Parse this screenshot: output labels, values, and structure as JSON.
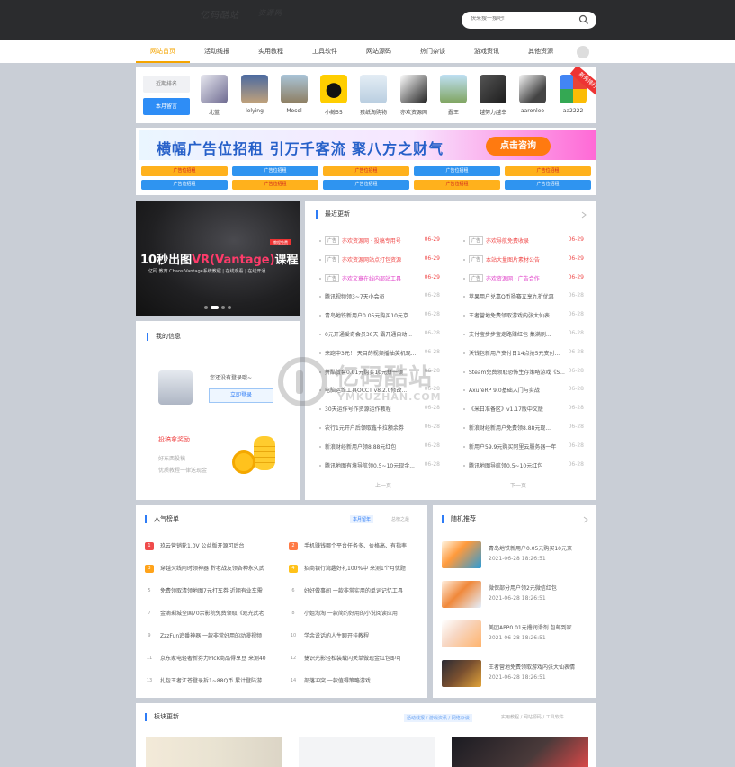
{
  "header": {
    "logo_text": "亿码酷站",
    "logo_sub": "资源网",
    "search_placeholder": "快来搜一搜吧!"
  },
  "nav": [
    "网站首页",
    "活动线报",
    "实用教程",
    "工具软件",
    "网站源码",
    "热门杂谈",
    "游戏资讯",
    "其他资源"
  ],
  "rank_tabs": [
    "近期排名",
    "本月留言"
  ],
  "users": [
    "北蓝",
    "lelying",
    "Mosol",
    "小鲸55",
    "孩纸淘购物",
    "亦欢资源网",
    "蠢王",
    "越努力越幸",
    "aaronleo",
    "aa2222"
  ],
  "ribbon": "新秀排行",
  "banner": {
    "text": "横幅广告位招租 引万千客流 聚八方之财气",
    "button": "点击咨询"
  },
  "ad_slots": [
    "广告位招租",
    "广告位招租",
    "广告位招租",
    "广告位招租",
    "广告位招租",
    "广告位招租",
    "广告位招租",
    "广告位招租",
    "广告位招租",
    "广告位招租"
  ],
  "slide": {
    "title_a": "10秒出图",
    "title_b": "VR(Vantage)",
    "title_c": "课程",
    "sub": "亿码 教育 Chaos Vantage系统教程 | 在线观看 | 在线开通",
    "tag": "教程免费"
  },
  "latest": {
    "title": "最近更新",
    "left": [
      {
        "tag": "广告",
        "text": "亦欢资源网 · 投稿专用号",
        "date": "06-29"
      },
      {
        "tag": "广告",
        "text": "亦欢资源网站点打包资源",
        "date": "06-29"
      },
      {
        "tag": "广告",
        "text": "亦欢文章在线内部站工具",
        "date": "06-29"
      },
      {
        "tag": "",
        "text": "腾讯视频领3~7天小会员",
        "date": "06-28"
      },
      {
        "tag": "",
        "text": "青岛地铁新用户0.05元购买10元京...",
        "date": "06-28"
      },
      {
        "tag": "",
        "text": "0元开通爱奇会员30天 霸开通自动...",
        "date": "06-28"
      },
      {
        "tag": "",
        "text": "来跑中3元！ 天目的视频播抽奖机现...",
        "date": "06-28"
      },
      {
        "tag": "",
        "text": "拼酷赞套0.01元购买10元拼一顿",
        "date": "06-28"
      },
      {
        "tag": "",
        "text": "电脑运维工具OCCT v8.2.0修改...",
        "date": "06-28"
      },
      {
        "tag": "",
        "text": "30天运作号作资源运作教程",
        "date": "06-28"
      },
      {
        "tag": "",
        "text": "农行1元开户后领取鑫卡拉额余券",
        "date": "06-28"
      },
      {
        "tag": "",
        "text": "新浪财经新用户领8.88元红包",
        "date": "06-28"
      },
      {
        "tag": "",
        "text": "腾讯地图有境导航领0.5~10元现金...",
        "date": "06-28"
      }
    ],
    "right": [
      {
        "tag": "广告",
        "text": "亦欢导航免费收录",
        "date": "06-29"
      },
      {
        "tag": "广告",
        "text": "本站大量图片素材公告",
        "date": "06-29"
      },
      {
        "tag": "广告",
        "text": "亦欢资源网 · 广告合作",
        "date": "06-29"
      },
      {
        "tag": "",
        "text": "苹果用户兑嘉Q币扬赛立享九折优惠",
        "date": "06-28"
      },
      {
        "tag": "",
        "text": "王者营地免费领取游戏内张大仙表...",
        "date": "06-28"
      },
      {
        "tag": "",
        "text": "支付宝步步宝走路赚红包 集满刷...",
        "date": "06-28"
      },
      {
        "tag": "",
        "text": "沃钱包新用户支付日14点抢5元支付...",
        "date": "06-28"
      },
      {
        "tag": "",
        "text": "Steam免费领取恐怖生存策略游戏《S...",
        "date": "06-28"
      },
      {
        "tag": "",
        "text": "AxureRP 9.0基础入门与实战",
        "date": "06-28"
      },
      {
        "tag": "",
        "text": "《米日准备区》v1.17版中文版",
        "date": "06-28"
      },
      {
        "tag": "",
        "text": "新浪财经新用户免费领8.88元现...",
        "date": "06-28"
      },
      {
        "tag": "",
        "text": "新用户59.9元购买阿里云服务器一年",
        "date": "06-28"
      },
      {
        "tag": "",
        "text": "腾讯地图导航领0.5~10元红包",
        "date": "06-28"
      }
    ],
    "prev": "上一页",
    "next": "下一页"
  },
  "myinfo": {
    "title": "我的信息",
    "not_logged": "您还没有登录哦~",
    "login": "立即登录",
    "reward": "投稿拿奖励",
    "desc1": "好东西投稿",
    "desc2": "优质教程一律送现金"
  },
  "popular": {
    "title": "人气榜单",
    "tabs": [
      "本月留年",
      "总榜之最"
    ],
    "items": [
      {
        "n": "1",
        "text": "玖云营销轮1.0V 公益版开源可后台"
      },
      {
        "n": "2",
        "text": "手机赚钱哪个平台任务多、价格高、有指率"
      },
      {
        "n": "3",
        "text": "穿越火线阿时领神器 黔老战友领各种永久武"
      },
      {
        "n": "4",
        "text": "招商银行湾趣好礼100%中 来测1个月优题"
      },
      {
        "n": "5",
        "text": "免费领取清领地图7元打车券 近期有业车需"
      },
      {
        "n": "6",
        "text": "好好做事间 一款非常实用的单词记忆工具"
      },
      {
        "n": "7",
        "text": "金滴剩城全国70余影院免费领取《观光武老"
      },
      {
        "n": "8",
        "text": "小姐淘淘 一款简约好用的小说阅读应用"
      },
      {
        "n": "9",
        "text": "ZzzFun追番神器 一款非常好用的动漫视频"
      },
      {
        "n": "10",
        "text": "学余说话的人生聊开挂教程"
      },
      {
        "n": "11",
        "text": "京东家电轻奢新券力Plck商品得享豆 来测40"
      },
      {
        "n": "12",
        "text": "捷识光影轻松装载闪关单做现金红包即可"
      },
      {
        "n": "13",
        "text": "扎包王者江苍登录拆1~88Q币 累计登陆游"
      },
      {
        "n": "14",
        "text": "部落冲突 一款值得策略游戏"
      }
    ]
  },
  "random": {
    "title": "随机推荐",
    "items": [
      {
        "text": "青岛地铁新用户0.05元购买10元京",
        "date": "2021-06-28 18:26:51"
      },
      {
        "text": "微保部分用户领2元微信红包",
        "date": "2021-06-28 18:26:51"
      },
      {
        "text": "美团APP0.01元撸润滑剂 包邮到家",
        "date": "2021-06-28 18:26:51"
      },
      {
        "text": "王者营地免费领取游戏内张大仙表情",
        "date": "2021-06-28 18:26:51"
      }
    ]
  },
  "blocks": {
    "title": "板块更新",
    "tabs_a": "活动线报 / 游戏资讯 / 网络杂谈",
    "tabs_b": "实用教程 / 网站源码 / 工具软件"
  },
  "watermark": {
    "a": "亿码酷站",
    "b": "YMKUZHAN.COM"
  },
  "colors": {
    "accent": "#f5a500",
    "blue": "#2e7cf6",
    "red": "#f04b4b"
  }
}
